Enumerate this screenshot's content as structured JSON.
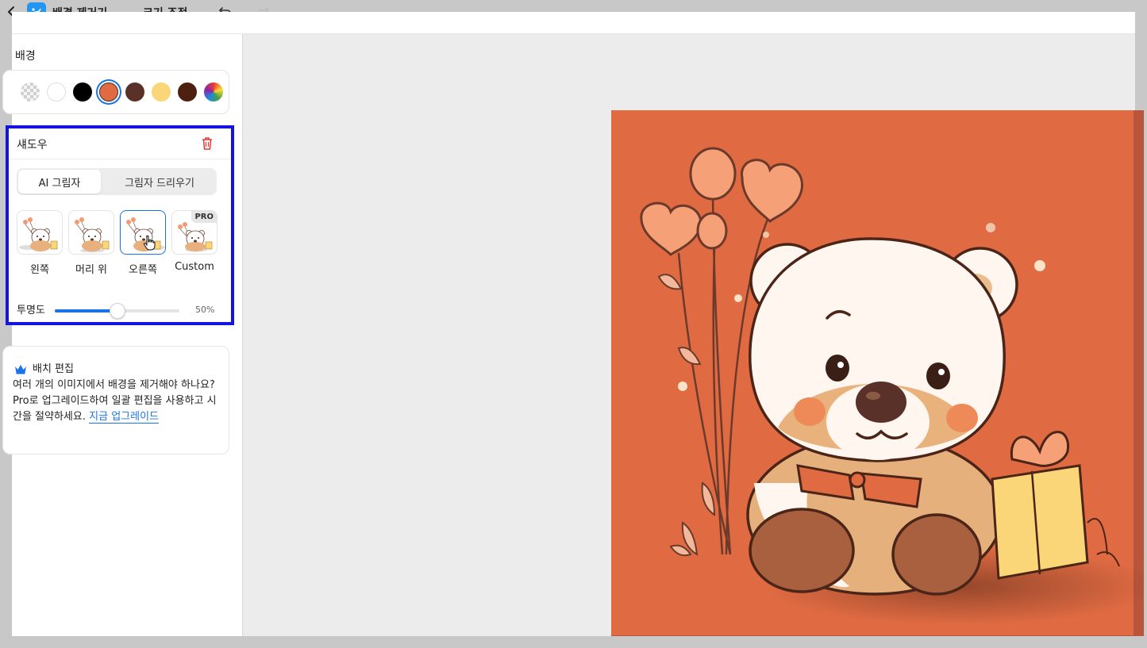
{
  "header": {
    "app_title": "배경 제거기",
    "resize_tab": "크기 조정"
  },
  "background_section": {
    "label": "배경",
    "swatches": [
      {
        "name": "transparent",
        "color": "transparent"
      },
      {
        "name": "white",
        "color": "#ffffff"
      },
      {
        "name": "black",
        "color": "#000000"
      },
      {
        "name": "orange",
        "color": "#e06b43",
        "selected": true
      },
      {
        "name": "dark-brown",
        "color": "#5a3128"
      },
      {
        "name": "light-yellow",
        "color": "#fbd679"
      },
      {
        "name": "deep-brown",
        "color": "#4d2111"
      },
      {
        "name": "rainbow",
        "color": "conic"
      }
    ]
  },
  "shadow": {
    "title": "섀도우",
    "tabs": {
      "ai": "AI 그림자",
      "drop": "그림자 드리우기"
    },
    "options": [
      {
        "label": "왼쪽"
      },
      {
        "label": "머리 위"
      },
      {
        "label": "오른쪽",
        "selected": true
      },
      {
        "label": "Custom",
        "badge": "PRO"
      }
    ],
    "opacity": {
      "label": "투명도",
      "value": 50,
      "value_text": "50%"
    }
  },
  "batch": {
    "title": "배치 편집",
    "description": "여러 개의 이미지에서 배경을 제거해야 하나요? Pro로 업그레이드하여 일괄 편집을 사용하고 시간을 절약하세요.",
    "link": "지금 업그레이드"
  },
  "colors": {
    "accent": "#1a73e8",
    "preview_bg": "#e06b43",
    "highlight_border": "#1414e0"
  }
}
